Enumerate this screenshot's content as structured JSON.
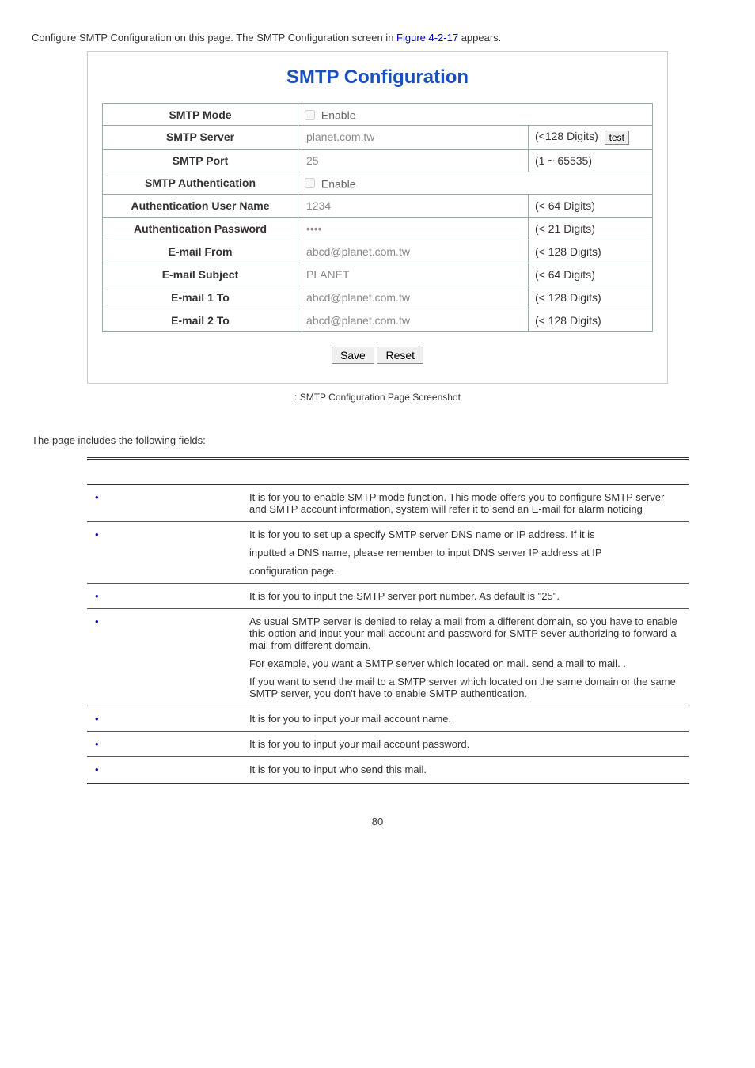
{
  "intro": {
    "text_1": "Configure SMTP Configuration on this page. The SMTP Configuration screen in ",
    "figure_ref": "Figure 4-2-17",
    "text_2": " appears."
  },
  "config": {
    "title": "SMTP Configuration",
    "rows": {
      "smtp_mode": {
        "label": "SMTP Mode",
        "checkbox_label": "Enable"
      },
      "smtp_server": {
        "label": "SMTP Server",
        "value": "planet.com.tw",
        "hint": "(<128 Digits)",
        "test_label": "test"
      },
      "smtp_port": {
        "label": "SMTP Port",
        "value": "25",
        "hint": "(1 ~ 65535)"
      },
      "smtp_auth": {
        "label": "SMTP Authentication",
        "checkbox_label": "Enable"
      },
      "auth_user": {
        "label": "Authentication User Name",
        "value": "1234",
        "hint": "(< 64 Digits)"
      },
      "auth_pass": {
        "label": "Authentication Password",
        "value": "••••",
        "hint": "(< 21 Digits)"
      },
      "email_from": {
        "label": "E-mail From",
        "value": "abcd@planet.com.tw",
        "hint": "(< 128 Digits)"
      },
      "email_subject": {
        "label": "E-mail Subject",
        "value": "PLANET",
        "hint": "(< 64 Digits)"
      },
      "email_1": {
        "label": "E-mail 1 To",
        "value": "abcd@planet.com.tw",
        "hint": "(< 128 Digits)"
      },
      "email_2": {
        "label": "E-mail 2 To",
        "value": "abcd@planet.com.tw",
        "hint": "(< 128 Digits)"
      }
    },
    "buttons": {
      "save": "Save",
      "reset": "Reset"
    }
  },
  "caption": ": SMTP Configuration Page Screenshot",
  "fields_note": "The page includes the following fields:",
  "desc_rows": [
    {
      "lines": [
        "It is for you to enable SMTP mode function. This mode offers you to configure SMTP server and SMTP account information, system will refer it to send an E-mail for alarm noticing"
      ]
    },
    {
      "lines": [
        "It is for you to set up a specify SMTP server DNS name or IP address. If it is",
        "inputted a DNS name, please remember to input DNS server IP address at IP",
        "configuration page."
      ]
    },
    {
      "lines": [
        "It is for you to input the SMTP server port number. As default is \"25\"."
      ]
    },
    {
      "lines": [
        "As usual SMTP server is denied to relay a mail from a different domain, so you have to enable this option and input your mail account and password for SMTP sever authorizing to forward a mail from different domain.",
        "For example, you want a SMTP server which located on mail.             send a mail to mail.                     .",
        "If you want to send the mail to a SMTP server which located on the same domain or the same SMTP server, you don't have to enable SMTP authentication."
      ]
    },
    {
      "lines": [
        "It is for you to input your mail account name."
      ]
    },
    {
      "lines": [
        "It is for you to input your mail account password."
      ]
    },
    {
      "lines": [
        "It is for you to input who send this mail."
      ]
    }
  ],
  "page_number": "80"
}
